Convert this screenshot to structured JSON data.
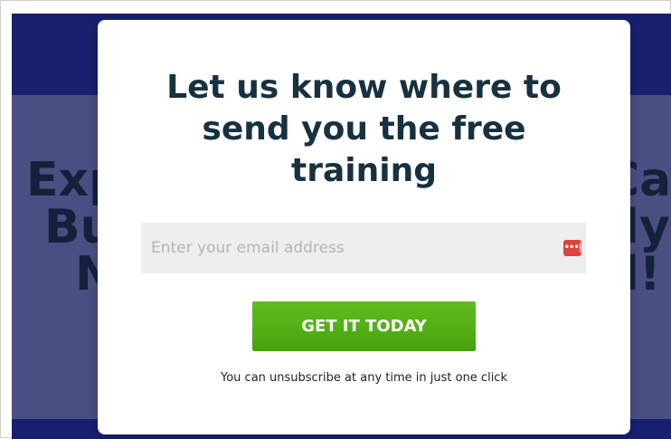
{
  "background_page": {
    "headline_fragments": {
      "line1_left": "Exp",
      "line1_right": "Ca",
      "line2_left": "Bu",
      "line2_right": "ly",
      "line3_left": "N",
      "line3_right": "l!"
    }
  },
  "modal": {
    "title": "Let us know where to send you the free training",
    "email": {
      "placeholder": "Enter your email address",
      "value": ""
    },
    "password_manager_icon": "•••|",
    "cta_label": "GET IT TODAY",
    "disclaimer": "You can unsubscribe at any time in just one click"
  },
  "colors": {
    "cta": "#52b014",
    "title": "#17313f",
    "page_header": "#16206e",
    "hero_dimmed": "#4b4e83"
  }
}
